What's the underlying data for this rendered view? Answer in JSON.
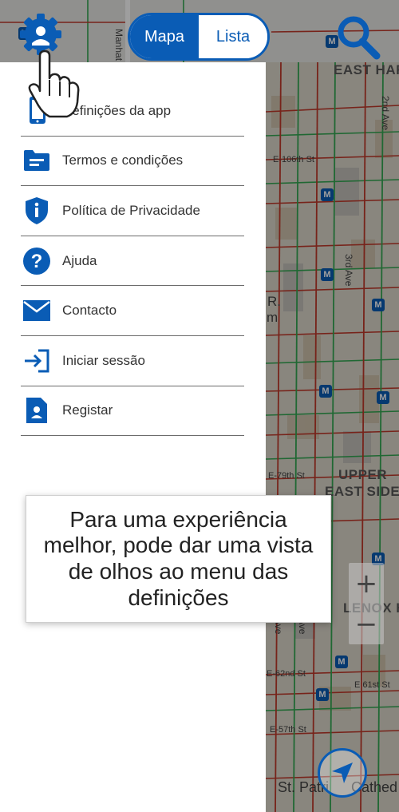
{
  "toggle": {
    "map_label": "Mapa",
    "list_label": "Lista"
  },
  "menu": {
    "items": [
      {
        "label": "Definições da app",
        "icon": "phone-settings-icon"
      },
      {
        "label": "Termos e condições",
        "icon": "folder-icon"
      },
      {
        "label": "Política de Privacidade",
        "icon": "shield-info-icon"
      },
      {
        "label": "Ajuda",
        "icon": "help-icon"
      },
      {
        "label": "Contacto",
        "icon": "mail-icon"
      },
      {
        "label": "Iniciar sessão",
        "icon": "login-icon"
      },
      {
        "label": "Registar",
        "icon": "user-document-icon"
      }
    ]
  },
  "tooltip": {
    "text": "Para uma experiência melhor, pode dar uma vista de olhos ao menu das definições"
  },
  "map": {
    "labels": {
      "east_harlem": "EAST HAR",
      "upper_east_side_1": "UPPER",
      "upper_east_side_2": "EAST SIDE",
      "lenox_hill": "LENOX HI",
      "st_patrick": "St. Patri",
      "cathedral": "Cathed",
      "manhattan": "Manhat",
      "e106": "E-106th St",
      "e79": "E-79th St",
      "e62": "E-62nd St",
      "e61": "E 61st St",
      "e57": "E-57th St",
      "third_ave": "3rd Ave",
      "second_ave": "2nd Ave",
      "ave": "Ave",
      "r_label": "R.",
      "m_label": "m"
    },
    "metro_letter": "M"
  },
  "zoom": {
    "in_label": "+",
    "out_label": "−"
  },
  "colors": {
    "brand": "#0a5cb5",
    "traffic_red": "#c0392b",
    "traffic_green": "#34a853"
  }
}
